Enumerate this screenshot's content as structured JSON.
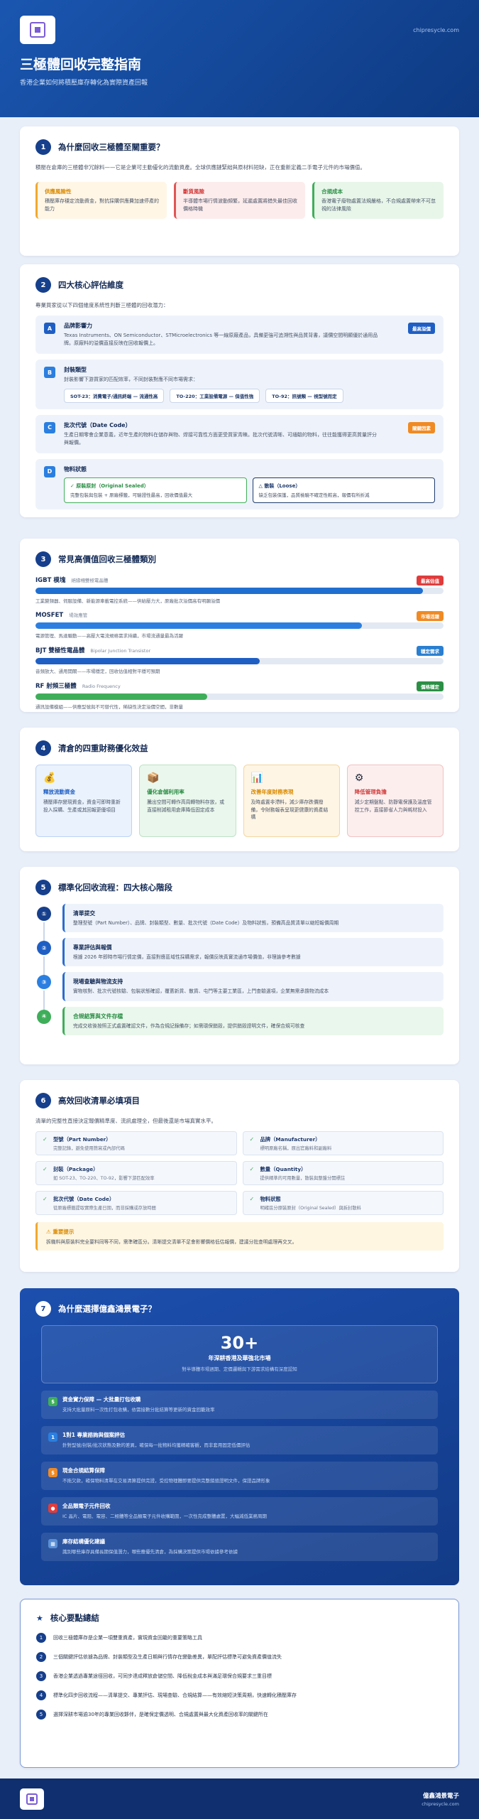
{
  "hero": {
    "site": "chipresycle.com",
    "title": "三極體回收完整指南",
    "subtitle": "香港企業如何將積壓庫存轉化為實際資產回報"
  },
  "s1": {
    "num": "1",
    "title": "為什麼回收三極體至關重要？",
    "intro": "積壓在倉庫的三極體非冗餘料——它是企業可主動優化的流動資產。全球供應鏈緊絀與原材料短缺，正在重新定義二手電子元件的市場價值。",
    "boxes": [
      {
        "t": "供應風險性",
        "d": "積壓庫存穩定流動資金，對抗採購供應費加速停產的能力"
      },
      {
        "t": "斷貨風險",
        "d": "半導體市場行情波動頻繁，延遲處置將錯失最佳回收價格時機"
      },
      {
        "t": "合規成本",
        "d": "香港電子廢物處置法規嚴格，不合規處置帶來不可忽視的法律風險"
      }
    ]
  },
  "s2": {
    "num": "2",
    "title": "四大核心評估維度",
    "intro": "專業買家從以下四個維度系統性判斷三極體的回收潛力：",
    "a": {
      "ltr": "A",
      "t": "品牌影響力",
      "d": "Texas Instruments、ON Semiconductor、STMicroelectronics 等一線原廠產品，具備更強可追溯性與品質背書，議價空間明顯優於通用品牌。原廠料的溢價直接反映在回收報價上。",
      "tag": "最高溢價"
    },
    "b": {
      "ltr": "B",
      "t": "封裝類型",
      "d": "封裝影響下游買家的匹配效率，不同封裝對應不同市場需求：",
      "pills": [
        "SOT-23：消費電子/通訊終端 — 流通性高",
        "TO-220：工業設備電源 — 保值性強",
        "TO-92：訊號類 — 視型號而定"
      ]
    },
    "c": {
      "ltr": "C",
      "t": "批次代號（Date Code）",
      "d": "生產日期零會企業意義，近年生產的物料在儲存與物、焊接可靠性方面更受買家青睞。批次代號清晰、可緬驗的物料，往往能獲得更高質量評分與報價。",
      "tag": "關鍵因素"
    },
    "d": {
      "ltr": "D",
      "t": "物料狀態",
      "sealed": {
        "a": "✓ 原裝原封（Original Sealed）",
        "b": "完整包裝與包裝 + 原廠標籤，可驗證性最高，回收價值最大"
      },
      "loose": {
        "a": "△ 散裝（Loose）",
        "b": "缺乏包裝保護，品質檢驗不確定性較高，報價有所折減"
      }
    }
  },
  "s3": {
    "num": "3",
    "title": "常見高價值回收三極體類別",
    "items": [
      {
        "name": "IGBT 模塊",
        "en": "絕緣柵雙極電晶體",
        "tag": "最高估值",
        "desc": "工業變頻器、伺服設備、新能源車載電控系統——供給壓力大，原廠批次溢價高有明顯溢價",
        "fill": 0.95,
        "color": "#1f6fd0",
        "tagc": "#e03c3c"
      },
      {
        "name": "MOSFET",
        "en": "場效應管",
        "tag": "市場活躍",
        "desc": "電源管理、馬達驅動——高壓大電流規格需求持續，市場流通量最為活躍",
        "fill": 0.8,
        "color": "#2c7fe0",
        "tagc": "#f08a24"
      },
      {
        "name": "BJT 雙極性電晶體",
        "en": "Bipolar Junction Transistor",
        "tag": "穩定需求",
        "desc": "音頻放大、通用開關——市場穩定，回收估值相對平穩可預期",
        "fill": 0.55,
        "color": "#1f5fc4",
        "tagc": "#2a7fd0"
      },
      {
        "name": "RF 射頻三極體",
        "en": "Radio Frequency",
        "tag": "價格穩定",
        "desc": "通訊設備模組——供應型號與不可替代性，稀缺性決定溢價空間，非數量",
        "fill": 0.42,
        "color": "#3fae5a",
        "tagc": "#2b8f45"
      }
    ]
  },
  "s4": {
    "num": "4",
    "title": "清倉的四重財務優化效益",
    "items": [
      {
        "t": "釋放流動資金",
        "d": "積壓庫存變現資金，資金可即時重新投入採購、生產或其回報更優項目"
      },
      {
        "t": "優化倉儲利用率",
        "d": "騰出空間可轉作高周轉物料存放，或直接削減租用倉庫降低固定成本"
      },
      {
        "t": "改善年度財務表現",
        "d": "及時處置非滯料，減少庫存跌價撥備，令財務報表呈現更健康的資產結構"
      },
      {
        "t": "降低管理負擔",
        "d": "減少定期盤點、防靜電保護及溫度管控工作，直接節省人力與耗材投入"
      }
    ]
  },
  "s5": {
    "num": "5",
    "title": "標準化回收流程：四大核心階段",
    "steps": [
      {
        "n": "①",
        "t": "清單提交",
        "d": "整理型號（Part Number）、品牌、封裝類型、數量、批次代號（Date Code）及物料狀態，預備高品質清單以縮短報價周期"
      },
      {
        "n": "②",
        "t": "專業評估與報價",
        "d": "根據 2026 年即時市場行情定價，直接對應區域性採購需求，報價反映真實流通市場價值，非理論參考數據"
      },
      {
        "n": "③",
        "t": "現場查驗與物流支持",
        "d": "實物核對、批次代號核驗、包裝狀態確認，覆蓋新貨、散貨、屯門等主要工業區，上門查驗選項，企業無需承擔物流成本"
      },
      {
        "n": "④",
        "t": "合規結算與文件存檔",
        "d": "完成交收後按照正式處置確認文件，作為合規記錄備存；如需環保銷毀，提供銷毀證明文件，確保合規可核查"
      }
    ]
  },
  "s6": {
    "num": "6",
    "title": "高效回收清單必填項目",
    "intro": "清單的完整性直接決定報價精準度、流訊處理全，但最後還是市場真實水平。",
    "items": [
      {
        "t": "型號（Part Number）",
        "d": "完整記錄，避免使用簡寫或內部代碼"
      },
      {
        "t": "品牌（Manufacturer）",
        "d": "標明原廠名稱，原出官廠料和副廠料"
      },
      {
        "t": "封裝（Package）",
        "d": "如 SOT-23、TO-220、TO-92，影響下游匹配效率"
      },
      {
        "t": "數量（Quantity）",
        "d": "提供精準的可用數量，散裝與整盤分開標註"
      },
      {
        "t": "批次代號（Date Code）",
        "d": "從原廠標籤提取實際生產日期，而非採購或存放時間"
      },
      {
        "t": "物料狀態",
        "d": "明確區分原裝原封（Original Sealed）與拆封散料"
      }
    ],
    "warn_t": "⚠ 重要提示",
    "warn_d": "拆機料與原裝料完全要料同等不同，需準確區分。清晰提交清單不足會影響價格低估報價，建議分批查明處理再交叉。"
  },
  "s7": {
    "num": "7",
    "title": "為什麼選擇億鑫鴻景電子？",
    "big_n": "30+",
    "big_l": "年深耕香港及華強北市場",
    "big_s": "對半導體市場週期、定價邏輯與下游需求結構有深度認知",
    "reasons": [
      {
        "ic": "$",
        "t": "資金實力保障 — 大批量打包收購",
        "d": "支持大批量原料一次性打包收購，依需接數分批結算等更新的資金回籠效率"
      },
      {
        "ic": "1",
        "t": "1對1 專業諮詢與個案評估",
        "d": "針對型號/封裝/批次狀態及數的差異，確保每一批物料均獲精確客觀，而非套用固定低價評估"
      },
      {
        "ic": "$",
        "t": "現金合規結算保障",
        "d": "不拖欠款，確保物料清單在交易清算提供完證，受控物理體即要提供完整銷毀證明文件，保證品牌形象"
      },
      {
        "ic": "●",
        "t": "全品類電子元件回收",
        "d": "IC 晶片、電阻、電容、二極體等全品類電子元件收購範圍，一次性完成整體處置，大幅減低業務周期"
      },
      {
        "ic": "▦",
        "t": "庫存結構優化建議",
        "d": "識別哪些庫存具備長期保值潛力，哪些應優先清倉，為採購決策提供市場依據參考依據"
      }
    ]
  },
  "s8": {
    "title": "核心要點總結",
    "items": [
      "回收三極體庫存是企業一項雙重資產，實現資金回籠的重要策略工具",
      "三個關鍵評估依據為品牌、封裝類型及生產日期與行情存在變動差異，單配評估標準可避免資產價值流失",
      "香港企業透過專業途徑回收，可同步達成釋放倉儲空間、降低稅金成本與滿足環保合規要求三重目標",
      "標準化四步回收流程——清單提交、專業評估、現場查驗、合規結算——有效縮短決策周期，快速轉化積壓庫存",
      "選擇深耕市場逾30年的專業回收夥伴，是確保定價透明、合規處置與最大化資產回收率的關鍵所在"
    ]
  },
  "footer": {
    "name": "億鑫鴻景電子",
    "site": "chipresycle.com"
  },
  "colors": {
    "primary": "#163f8c",
    "accent": "#1f6fd0",
    "green": "#3fae5a",
    "orange": "#f0a830",
    "red": "#e03c3c"
  }
}
